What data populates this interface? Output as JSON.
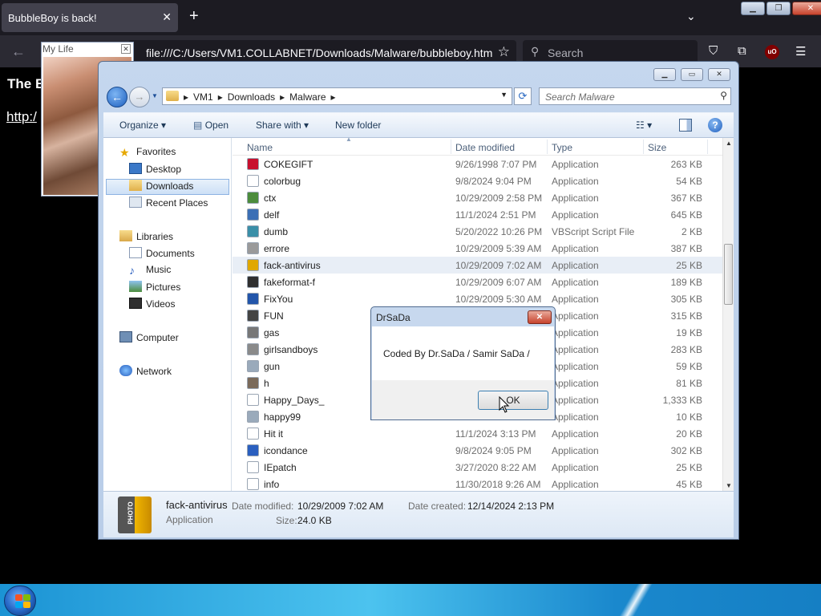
{
  "browser": {
    "tab_title": "BubbleBoy is back!",
    "tab_close": "✕",
    "new_tab": "+",
    "url": "file:///C:/Users/VM1.COLLABNET/Downloads/Malware/bubbleboy.htm",
    "search_placeholder": "Search",
    "ublock_badge": "uO"
  },
  "page": {
    "heading": "The B",
    "link": "http:/"
  },
  "mylife_window": {
    "title": "My Life",
    "close": "✕"
  },
  "explorer": {
    "breadcrumbs": [
      "VM1",
      "Downloads",
      "Malware"
    ],
    "search_placeholder": "Search Malware",
    "commands": {
      "organize": "Organize",
      "open": "Open",
      "share_with": "Share with",
      "new_folder": "New folder"
    },
    "nav": {
      "favorites": "Favorites",
      "desktop": "Desktop",
      "downloads": "Downloads",
      "recent_places": "Recent Places",
      "libraries": "Libraries",
      "documents": "Documents",
      "music": "Music",
      "pictures": "Pictures",
      "videos": "Videos",
      "computer": "Computer",
      "network": "Network"
    },
    "columns": {
      "name": "Name",
      "date_modified": "Date modified",
      "type": "Type",
      "size": "Size"
    },
    "files": [
      {
        "name": "COKEGIFT",
        "date": "9/26/1998 7:07 PM",
        "type": "Application",
        "size": "263 KB",
        "color": "#c8102e"
      },
      {
        "name": "colorbug",
        "date": "9/8/2024 9:04 PM",
        "type": "Application",
        "size": "54 KB",
        "color": "#ffffff"
      },
      {
        "name": "ctx",
        "date": "10/29/2009 2:58 PM",
        "type": "Application",
        "size": "367 KB",
        "color": "#4c8c3c"
      },
      {
        "name": "delf",
        "date": "11/1/2024 2:51 PM",
        "type": "Application",
        "size": "645 KB",
        "color": "#3b6fb5"
      },
      {
        "name": "dumb",
        "date": "5/20/2022 10:26 PM",
        "type": "VBScript Script File",
        "size": "2 KB",
        "color": "#3a8fa8"
      },
      {
        "name": "errore",
        "date": "10/29/2009 5:39 AM",
        "type": "Application",
        "size": "387 KB",
        "color": "#9a9a9a"
      },
      {
        "name": "fack-antivirus",
        "date": "10/29/2009 7:02 AM",
        "type": "Application",
        "size": "25 KB",
        "color": "#e0a800"
      },
      {
        "name": "fakeformat-f",
        "date": "10/29/2009 6:07 AM",
        "type": "Application",
        "size": "189 KB",
        "color": "#2f2f2f"
      },
      {
        "name": "FixYou",
        "date": "10/29/2009 5:30 AM",
        "type": "Application",
        "size": "305 KB",
        "color": "#2255aa"
      },
      {
        "name": "FUN",
        "date": "",
        "type": "Application",
        "size": "315 KB",
        "color": "#444444"
      },
      {
        "name": "gas",
        "date": "",
        "type": "Application",
        "size": "19 KB",
        "color": "#777777"
      },
      {
        "name": "girlsandboys",
        "date": "",
        "type": "Application",
        "size": "283 KB",
        "color": "#8a8a8a"
      },
      {
        "name": "gun",
        "date": "",
        "type": "Application",
        "size": "59 KB",
        "color": "#9aaabb"
      },
      {
        "name": "h",
        "date": "",
        "type": "Application",
        "size": "81 KB",
        "color": "#7a6a5a"
      },
      {
        "name": "Happy_Days_",
        "date": "",
        "type": "Application",
        "size": "1,333 KB",
        "color": "#ffffff"
      },
      {
        "name": "happy99",
        "date": "",
        "type": "Application",
        "size": "10 KB",
        "color": "#9aaabb"
      },
      {
        "name": "Hit it",
        "date": "11/1/2024 3:13 PM",
        "type": "Application",
        "size": "20 KB",
        "color": "#ffffff"
      },
      {
        "name": "icondance",
        "date": "9/8/2024 9:05 PM",
        "type": "Application",
        "size": "302 KB",
        "color": "#2a5fbf"
      },
      {
        "name": "IEpatch",
        "date": "3/27/2020 8:22 AM",
        "type": "Application",
        "size": "25 KB",
        "color": "#ffffff"
      },
      {
        "name": "info",
        "date": "11/30/2018 9:26 AM",
        "type": "Application",
        "size": "45 KB",
        "color": "#ffffff"
      }
    ],
    "details": {
      "name": "fack-antivirus",
      "type": "Application",
      "date_modified_label": "Date modified:",
      "date_modified": "10/29/2009 7:02 AM",
      "date_created_label": "Date created:",
      "date_created": "12/14/2024 2:13 PM",
      "size_label": "Size:",
      "size": "24.0 KB",
      "icon_text": "PHOTO"
    }
  },
  "dialog": {
    "title": "DrSaDa",
    "message": "Coded By Dr.SaDa / Samir SaDa /",
    "ok": "OK",
    "close": "✕"
  }
}
